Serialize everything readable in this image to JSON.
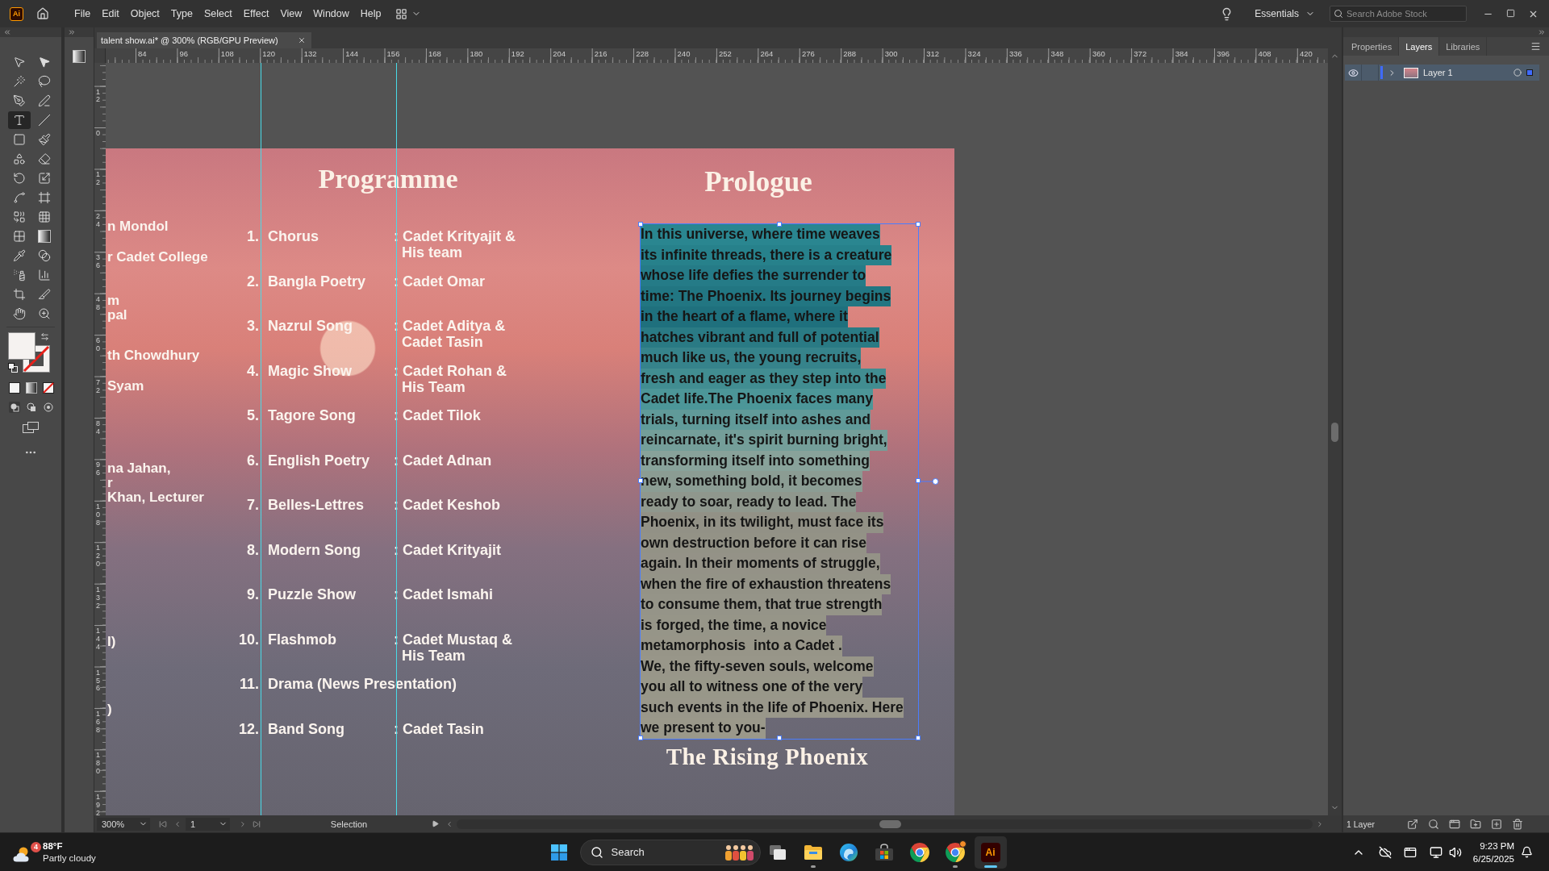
{
  "app": {
    "logo": "Ai"
  },
  "menu": [
    "File",
    "Edit",
    "Object",
    "Type",
    "Select",
    "Effect",
    "View",
    "Window",
    "Help"
  ],
  "workspace": "Essentials",
  "stock_search": {
    "placeholder": "Search Adobe Stock"
  },
  "document_tab": {
    "title": "talent show.ai* @ 300% (RGB/GPU Preview)"
  },
  "tools": [
    {
      "kind": "selection",
      "selected": false
    },
    {
      "kind": "direct-selection",
      "selected": false
    },
    {
      "kind": "magic-wand",
      "selected": false
    },
    {
      "kind": "lasso",
      "selected": false
    },
    {
      "kind": "pen",
      "selected": false
    },
    {
      "kind": "curvature",
      "selected": false
    },
    {
      "kind": "type",
      "selected": true
    },
    {
      "kind": "line",
      "selected": false
    },
    {
      "kind": "rectangle",
      "selected": false
    },
    {
      "kind": "paintbrush",
      "selected": false
    },
    {
      "kind": "shaper",
      "selected": false
    },
    {
      "kind": "eraser",
      "selected": false
    },
    {
      "kind": "rotate",
      "selected": false
    },
    {
      "kind": "scale",
      "selected": false
    },
    {
      "kind": "width",
      "selected": false
    },
    {
      "kind": "free-transform",
      "selected": false
    },
    {
      "kind": "shape-builder",
      "selected": false
    },
    {
      "kind": "perspective-grid",
      "selected": false
    },
    {
      "kind": "mesh",
      "selected": false
    },
    {
      "kind": "gradient",
      "selected": false
    },
    {
      "kind": "eyedropper",
      "selected": false
    },
    {
      "kind": "blend",
      "selected": false
    },
    {
      "kind": "symbol-sprayer",
      "selected": false
    },
    {
      "kind": "column-graph",
      "selected": false
    },
    {
      "kind": "artboard",
      "selected": false
    },
    {
      "kind": "slice",
      "selected": false
    },
    {
      "kind": "hand",
      "selected": false
    },
    {
      "kind": "zoom",
      "selected": false
    }
  ],
  "rulers": {
    "horizontal": [
      "84",
      "96",
      "108",
      "120",
      "132",
      "144",
      "156",
      "168",
      "180",
      "192",
      "204",
      "216",
      "228",
      "240",
      "252",
      "264",
      "276",
      "288",
      "300",
      "312",
      "324",
      "336",
      "348",
      "360",
      "372",
      "384",
      "396",
      "408",
      "420"
    ],
    "vertical": [
      "12",
      "0",
      "12",
      "24",
      "36",
      "48",
      "60",
      "72",
      "84",
      "96",
      "108",
      "120",
      "132",
      "144",
      "156",
      "168",
      "180",
      "192"
    ]
  },
  "artboard": {
    "fragments": [
      {
        "lines": [
          "n Mondol"
        ]
      },
      {
        "lines": [
          "r Cadet College"
        ]
      },
      {
        "lines": [
          "m",
          "pal"
        ]
      },
      {
        "lines": [
          "th Chowdhury"
        ]
      },
      {
        "lines": [
          "Syam"
        ]
      },
      {
        "lines": [
          "na Jahan,",
          "r",
          "Khan, Lecturer"
        ]
      },
      {
        "lines": [
          "I)"
        ]
      },
      {
        "lines": [
          ")"
        ]
      }
    ],
    "programme": {
      "title": "Programme",
      "items": [
        {
          "number": "1.",
          "title": "Chorus",
          "performer": [
            ": Cadet Krityajit &",
            "His team"
          ]
        },
        {
          "number": "2.",
          "title": "Bangla Poetry",
          "performer": [
            ": Cadet Omar"
          ]
        },
        {
          "number": "3.",
          "title": "Nazrul Song",
          "performer": [
            ": Cadet Aditya &",
            "Cadet Tasin"
          ]
        },
        {
          "number": "4.",
          "title": "Magic Show",
          "performer": [
            ": Cadet Rohan &",
            "His Team"
          ]
        },
        {
          "number": "5.",
          "title": "Tagore Song",
          "performer": [
            ": Cadet Tilok"
          ]
        },
        {
          "number": "6.",
          "title": "English Poetry",
          "performer": [
            ": Cadet Adnan"
          ]
        },
        {
          "number": "7.",
          "title": "Belles-Lettres",
          "performer": [
            ": Cadet Keshob"
          ]
        },
        {
          "number": "8.",
          "title": "Modern Song",
          "performer": [
            ": Cadet Krityajit"
          ]
        },
        {
          "number": "9.",
          "title": "Puzzle Show",
          "performer": [
            ": Cadet Ismahi"
          ]
        },
        {
          "number": "10.",
          "title": "Flashmob",
          "performer": [
            ": Cadet Mustaq &",
            "His Team"
          ]
        },
        {
          "number": "11.",
          "title": "Drama (News Presentation)"
        },
        {
          "number": "12.",
          "title": "Band Song",
          "performer": [
            ": Cadet Tasin"
          ]
        }
      ]
    },
    "prologue": {
      "title": "Prologue",
      "selected": true,
      "lines": [
        "In this universe, where time weaves",
        "its infinite threads, there is a creature",
        "whose life defies the surrender to",
        "time: The Phoenix. Its journey begins",
        "in the heart of a flame, where it",
        "hatches vibrant and full of potential",
        "much like us, the young recruits,",
        "fresh and eager as they step into the",
        "Cadet life.The Phoenix faces many",
        "trials, turning itself into ashes and",
        "reincarnate, it's spirit burning bright,",
        "transforming itself into something",
        "new, something bold, it becomes",
        "ready to soar, ready to lead. The",
        "Phoenix, in its twilight, must face its",
        "own destruction before it can rise",
        "again. In their moments of struggle,",
        "when the fire of exhaustion threatens",
        "to consume them, that true strength",
        "is forged, the time, a novice",
        "metamorphosis  into a Cadet .",
        "We, the fifty-seven souls, welcome",
        "you all to witness one of the very",
        "such events in the life of Phoenix. Here",
        "we present to you-"
      ]
    },
    "closing_title": "The Rising Phoenix"
  },
  "panel": {
    "tabs": [
      {
        "label": "Properties",
        "selected": false
      },
      {
        "label": "Layers",
        "selected": true
      },
      {
        "label": "Libraries",
        "selected": false
      }
    ],
    "layers": [
      {
        "name": "Layer 1",
        "visible": true,
        "expanded": false,
        "selected": true
      }
    ],
    "footer": "1 Layer"
  },
  "status_bar": {
    "zoom": "300%",
    "page": "1",
    "tool": "Selection"
  },
  "taskbar": {
    "weather": {
      "badge": "4",
      "temperature": "88°F",
      "condition": "Partly cloudy"
    },
    "search": {
      "placeholder": "Search"
    },
    "apps": [
      {
        "kind": "task-view",
        "running": false,
        "active": false,
        "notification": false
      },
      {
        "kind": "file-explorer",
        "running": true,
        "active": false,
        "notification": false
      },
      {
        "kind": "edge",
        "running": false,
        "active": false,
        "notification": false
      },
      {
        "kind": "store",
        "running": false,
        "active": false,
        "notification": false
      },
      {
        "kind": "chrome",
        "running": false,
        "active": false,
        "notification": false
      },
      {
        "kind": "chrome",
        "running": true,
        "active": false,
        "notification": true
      },
      {
        "kind": "illustrator",
        "running": true,
        "active": true,
        "notification": false,
        "label": "Ai"
      }
    ],
    "time": "9:23 PM",
    "date": "6/25/2025"
  }
}
